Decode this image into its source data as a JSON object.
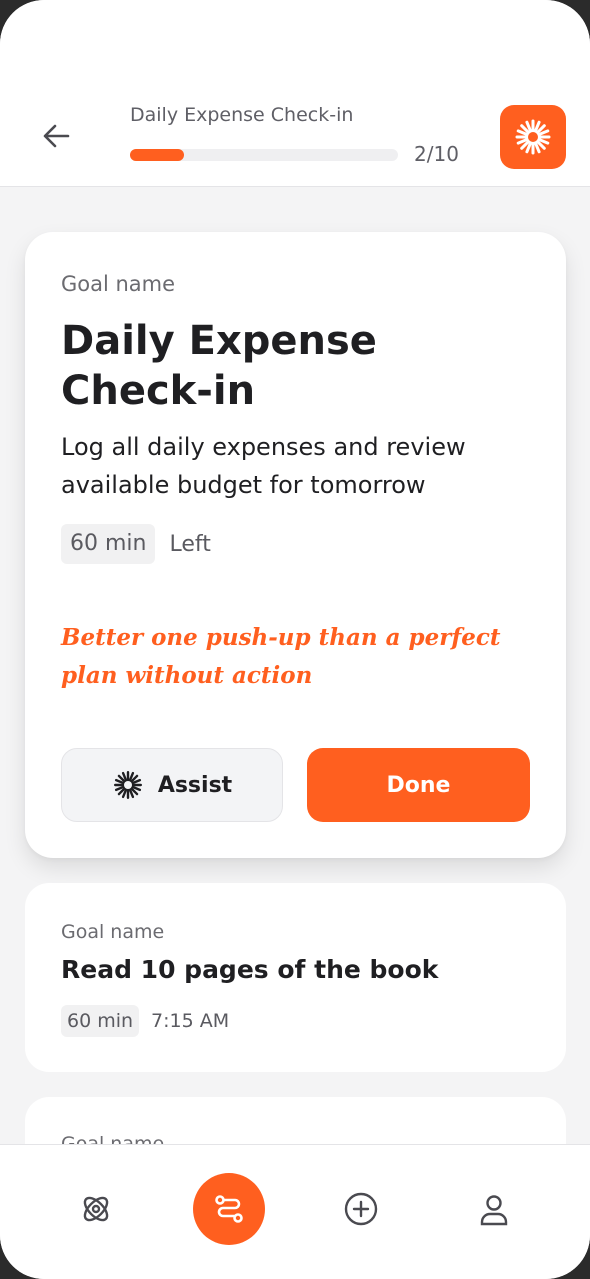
{
  "header": {
    "title": "Daily Expense Check-in",
    "progress": {
      "current": 2,
      "total": 10,
      "fraction": 0.2,
      "label": "2/10"
    }
  },
  "colors": {
    "accent": "#ff5f1f",
    "background": "#f4f4f5",
    "text": "#1f1f22",
    "muted": "#6b6b70"
  },
  "current_goal": {
    "label": "Goal name",
    "title": "Daily Expense Check-in",
    "description": "Log all daily expenses and review available budget for tomorrow",
    "duration": "60 min",
    "duration_suffix": "Left",
    "quote": "Better one push-up than a perfect plan without action",
    "assist_label": "Assist",
    "done_label": "Done"
  },
  "next_goal": {
    "label": "Goal name",
    "title": "Read 10 pages of the book",
    "duration": "60 min",
    "time": "7:15 AM"
  },
  "peek_goal": {
    "label": "Goal name"
  },
  "tabbar": {
    "items": [
      {
        "icon": "orbit-icon",
        "active": false
      },
      {
        "icon": "route-icon",
        "active": true
      },
      {
        "icon": "add-circle-icon",
        "active": false
      },
      {
        "icon": "profile-icon",
        "active": false
      }
    ]
  }
}
